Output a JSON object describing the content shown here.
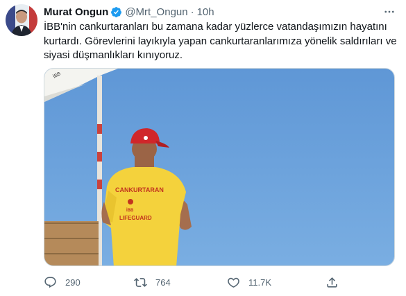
{
  "author": {
    "name": "Murat Ongun",
    "handle": "@Mrt_Ongun",
    "separator": "·",
    "time": "10h"
  },
  "tweet": {
    "line1": "İBB'nin cankurtaranları bu zamana kadar yüzlerce vatandaşımızın hayatını",
    "line2": "kurtardı. Görevlerini layıkıyla yapan cankurtaranlarımıza yönelik saldırıları ve",
    "line3": "siyasi düşmanlıkları kınıyoruz."
  },
  "media": {
    "shirt_line1": "CANKURTARAN",
    "shirt_line2": "İBB",
    "shirt_line3": "LIFEGUARD",
    "flag_text": "İBB"
  },
  "actions": {
    "reply_count": "290",
    "retweet_count": "764",
    "like_count": "11.7K"
  },
  "colors": {
    "verified": "#1d9bf0",
    "sky": "#6a9fd8",
    "shirt": "#f4d23c",
    "cap": "#d0262a",
    "muted": "#536471"
  },
  "icons": [
    "verified-badge-icon",
    "more-icon",
    "reply-icon",
    "retweet-icon",
    "like-icon",
    "share-icon"
  ]
}
